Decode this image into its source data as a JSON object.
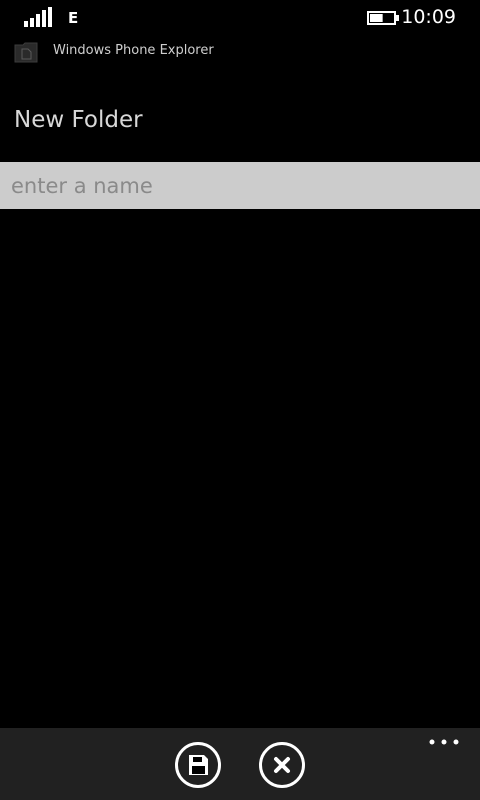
{
  "status_bar": {
    "signal_icon": "signal-strength-icon",
    "network_type": "E",
    "battery_icon": "battery-icon",
    "battery_level": 0.55,
    "time": "10:09"
  },
  "app_header": {
    "icon": "folder-app-icon",
    "title": "Windows Phone Explorer"
  },
  "page": {
    "title": "New Folder"
  },
  "name_input": {
    "value": "",
    "placeholder": "enter a name"
  },
  "app_bar": {
    "background": "#212121",
    "buttons": [
      {
        "icon": "save-icon"
      },
      {
        "icon": "cancel-icon"
      }
    ],
    "more_icon": "more-ellipsis-icon"
  }
}
